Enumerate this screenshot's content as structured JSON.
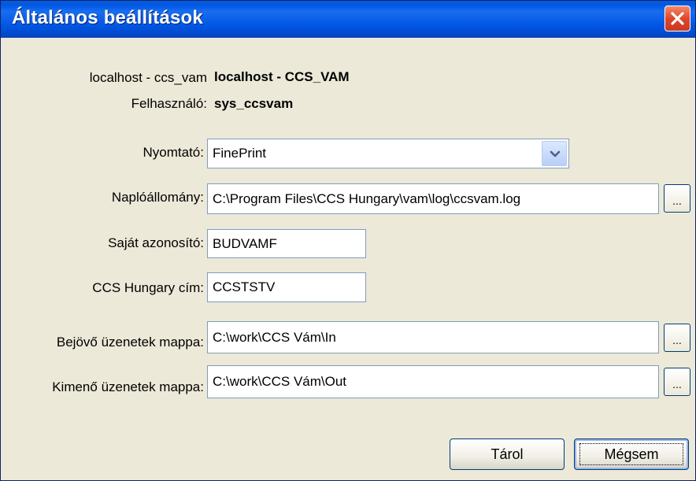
{
  "window": {
    "title": "Általános beállítások"
  },
  "info": {
    "connection_label": "localhost - ccs_vam",
    "connection_value": "localhost - CCS_VAM",
    "user_label": "Felhasználó:",
    "user_value": "sys_ccsvam"
  },
  "form": {
    "printer": {
      "label": "Nyomtató:",
      "value": "FinePrint"
    },
    "logfile": {
      "label": "Naplóállomány:",
      "value": "C:\\Program Files\\CCS Hungary\\vam\\log\\ccsvam.log",
      "browse_label": "..."
    },
    "own_id": {
      "label": "Saját azonosító:",
      "value": "BUDVAMF"
    },
    "ccs_address": {
      "label": "CCS Hungary cím:",
      "value": "CCSTSTV"
    },
    "incoming": {
      "label": "Bejövő üzenetek mappa:",
      "value": "C:\\work\\CCS Vám\\In",
      "browse_label": "..."
    },
    "outgoing": {
      "label": "Kimenő üzenetek mappa:",
      "value": "C:\\work\\CCS Vám\\Out",
      "browse_label": "..."
    }
  },
  "buttons": {
    "save": "Tárol",
    "cancel": "Mégsem"
  }
}
